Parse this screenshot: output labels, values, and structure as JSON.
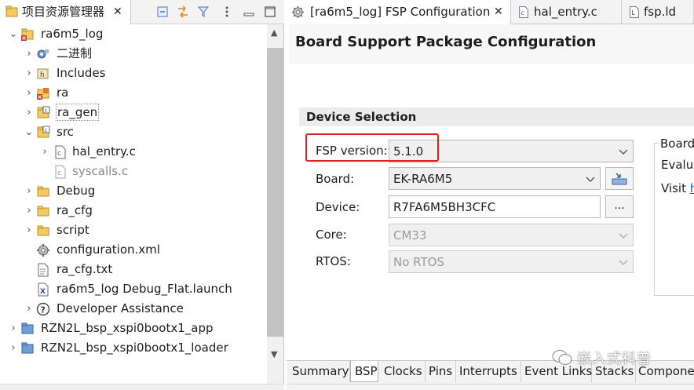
{
  "explorer": {
    "tab_title": "项目资源管理器",
    "close_glyph": "✕",
    "items": [
      {
        "label": "ra6m5_log",
        "expanded": true,
        "icon": "project-error-icon"
      },
      {
        "label": "二进制",
        "icon": "binaries-icon"
      },
      {
        "label": "Includes",
        "icon": "includes-icon"
      },
      {
        "label": "ra",
        "icon": "folder-error-icon"
      },
      {
        "label": "ra_gen",
        "icon": "source-folder-icon"
      },
      {
        "label": "src",
        "expanded": true,
        "icon": "source-folder-icon"
      },
      {
        "label": "hal_entry.c",
        "icon": "c-file-icon"
      },
      {
        "label": "syscalls.c",
        "icon": "c-file-icon"
      },
      {
        "label": "Debug",
        "icon": "folder-icon"
      },
      {
        "label": "ra_cfg",
        "icon": "folder-icon"
      },
      {
        "label": "script",
        "icon": "folder-icon"
      },
      {
        "label": "configuration.xml",
        "icon": "gear-file-icon"
      },
      {
        "label": "ra_cfg.txt",
        "icon": "text-file-icon"
      },
      {
        "label": "ra6m5_log Debug_Flat.launch",
        "icon": "launch-file-icon"
      },
      {
        "label": "Developer Assistance",
        "icon": "help-icon"
      },
      {
        "label": "RZN2L_bsp_xspi0bootx1_app",
        "icon": "project-folder-icon"
      },
      {
        "label": "RZN2L_bsp_xspi0bootx1_loader",
        "icon": "project-folder-icon"
      }
    ]
  },
  "editor": {
    "tabs": [
      {
        "label": "[ra6m5_log] FSP Configuration",
        "active": true,
        "icon": "gear-icon"
      },
      {
        "label": "hal_entry.c",
        "icon": "c-file-icon"
      },
      {
        "label": "fsp.ld",
        "icon": "ld-file-icon"
      }
    ],
    "close_glyph": "✕",
    "page_title": "Board Support Package Configuration",
    "section_title": "Device Selection",
    "fields": {
      "fsp_version": {
        "label": "FSP version:",
        "value": "5.1.0"
      },
      "board": {
        "label": "Board:",
        "value": "EK-RA6M5"
      },
      "device": {
        "label": "Device:",
        "value": "R7FA6M5BH3CFC",
        "button": "..."
      },
      "core": {
        "label": "Core:",
        "value": "CM33"
      },
      "rtos": {
        "label": "RTOS:",
        "value": "No RTOS"
      }
    },
    "board_info": {
      "title": "Board",
      "line1": "Evalua",
      "line2_prefix": "Visit ",
      "line2_link": "h"
    },
    "bottom_tabs": [
      "Summary",
      "BSP",
      "Clocks",
      "Pins",
      "Interrupts",
      "Event Links",
      "Stacks",
      "Compone"
    ],
    "active_bottom_tab": "BSP",
    "highlight_color": "#e02020",
    "watermark": "嵌入式科普"
  }
}
